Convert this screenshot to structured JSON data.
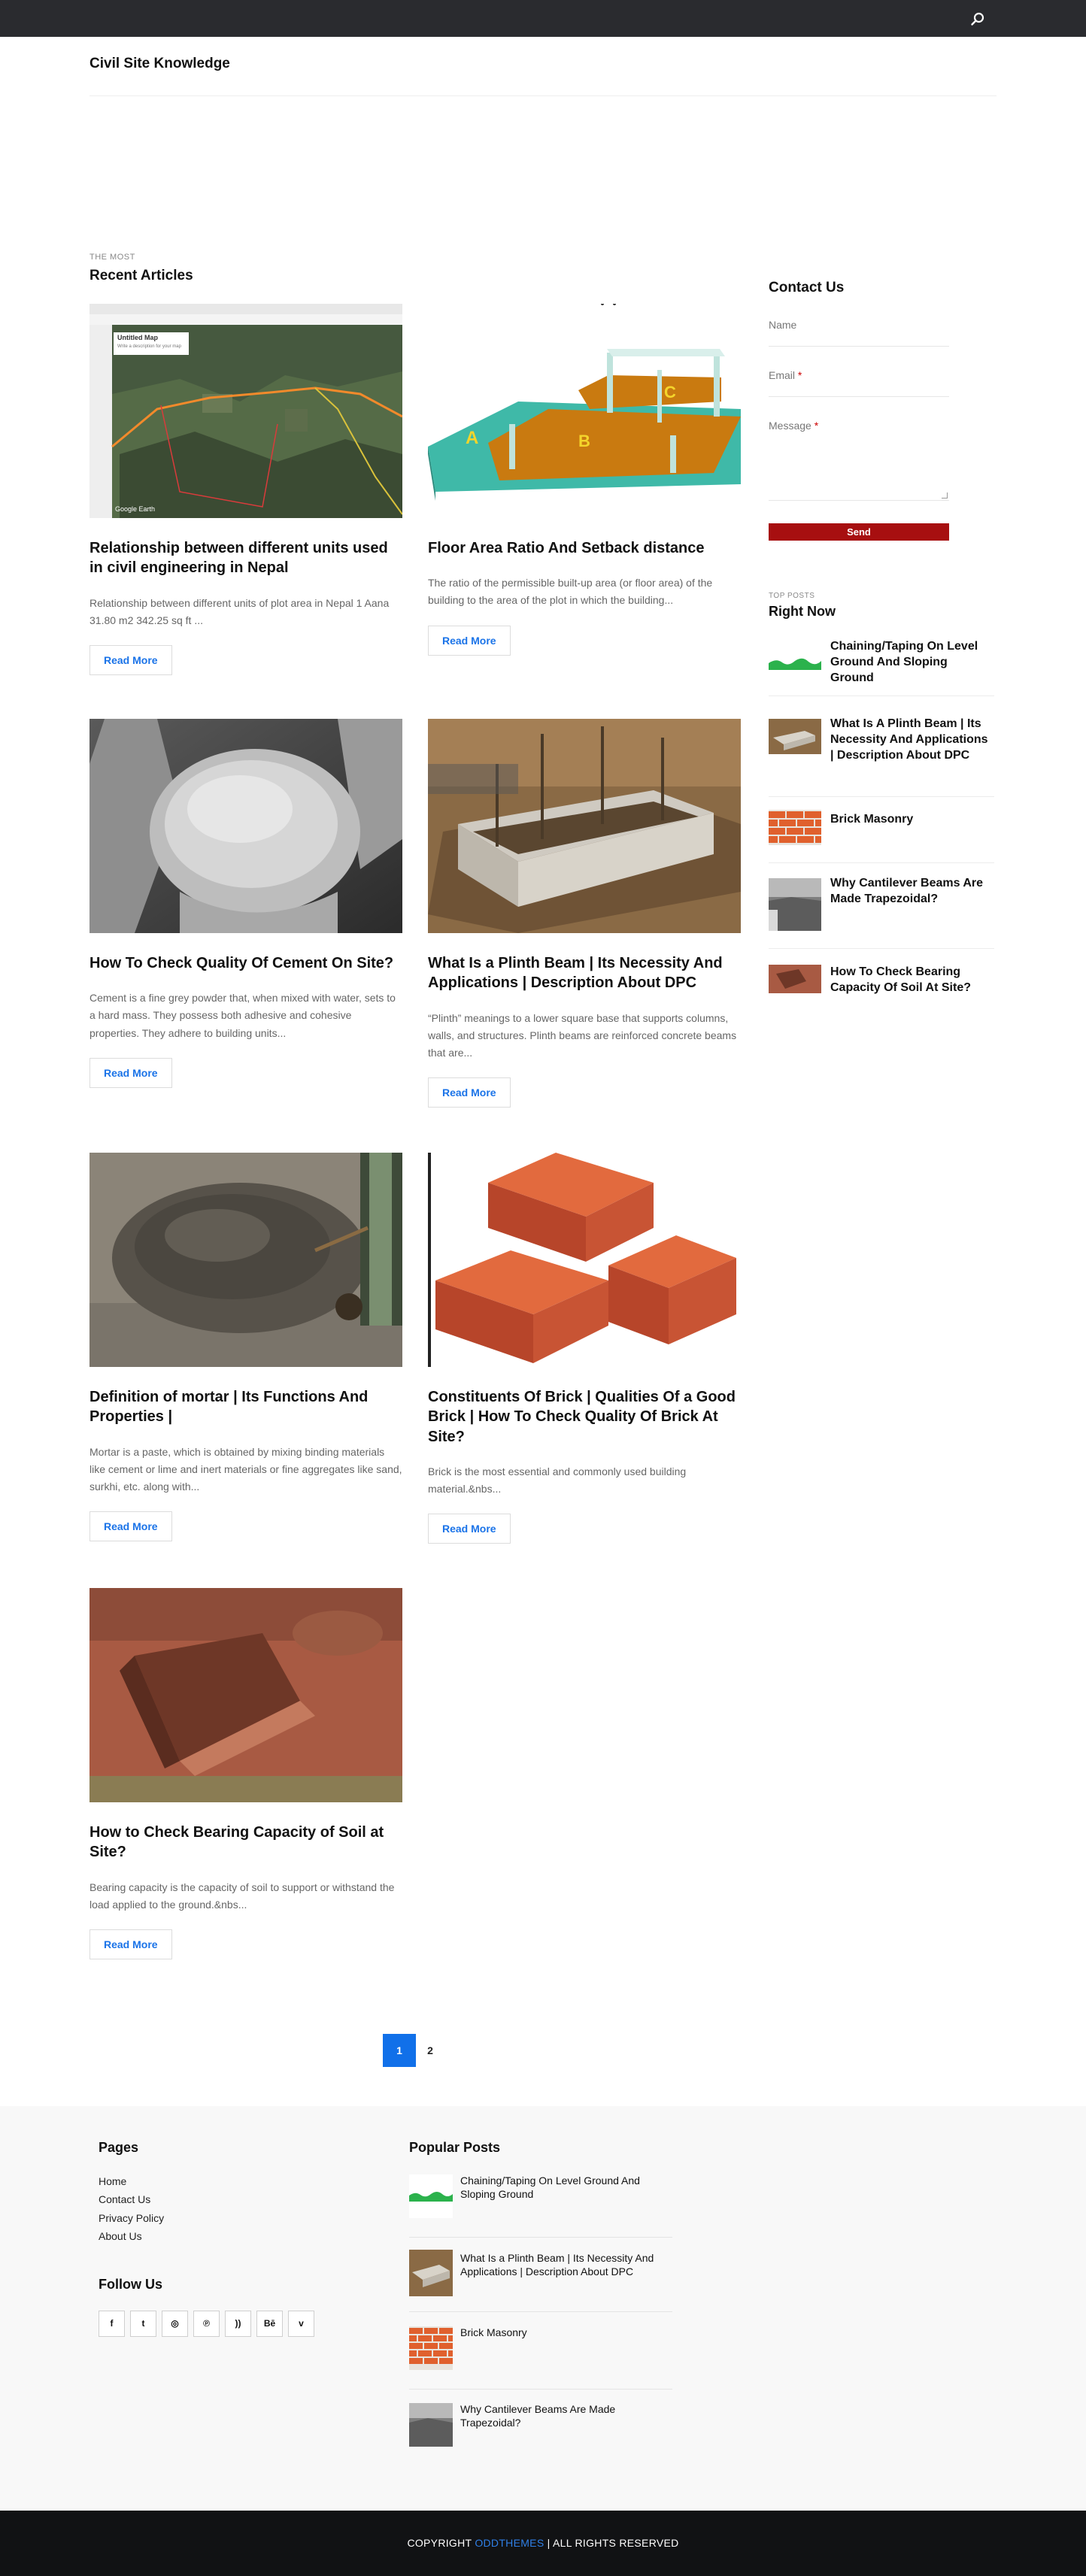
{
  "site": {
    "title": "Civil Site Knowledge"
  },
  "main": {
    "kicker": "The Most",
    "title": "Recent Articles",
    "read_more_label": "Read More",
    "articles": [
      {
        "title": "Relationship between different units used in civil engineering in Nepal",
        "excerpt": " Relationship between different units of plot area in Nepal   1 Aana 31.80 m2   342.25 sq ft     ...",
        "image": "satellite-map-image"
      },
      {
        "title": "Floor Area Ratio And Setback distance",
        "excerpt": "        The ratio of the permissible built-up area (or floor area) of the building to the area of the plot in which the building...",
        "image": "floor-area-diagram-image"
      },
      {
        "title": "How To Check Quality Of Cement On Site?",
        "excerpt": "Cement is a fine grey powder that, when mixed with water, sets to a hard mass. They possess both adhesive and cohesive properties. They adhere to building units...",
        "image": "cement-hands-image"
      },
      {
        "title": "What Is a Plinth Beam | Its Necessity And Applications | Description About DPC",
        "excerpt": "    “Plinth” meanings to a lower square base that supports columns, walls, and structures. Plinth beams are reinforced concrete beams that are...",
        "image": "plinth-beam-image"
      },
      {
        "title": "Definition of mortar | Its Functions And Properties |",
        "excerpt": "Mortar is a paste, which is obtained by mixing binding materials like cement or lime and inert materials or fine aggregates like sand, surkhi, etc. along with...",
        "image": "mortar-image"
      },
      {
        "title": "Constituents Of Brick | Qualities Of a Good Brick | How To Check Quality Of Brick At Site?",
        "excerpt": "Brick is the most essential and commonly used building material.&nbs...",
        "image": "bricks-image"
      },
      {
        "title": "How to Check Bearing Capacity of Soil at Site?",
        "excerpt": " Bearing capacity is the capacity of soil to support or withstand the load applied to the ground.&nbs...",
        "image": "soil-pit-image"
      }
    ],
    "map_card": {
      "map_title": "Untitled Map",
      "map_sub": "Write a description for your map",
      "watermark": "Google Earth"
    },
    "diagram_labels": [
      "A",
      "B",
      "C"
    ]
  },
  "sidebar": {
    "contact": {
      "title": "Contact Us",
      "name_label": "Name",
      "email_label": "Email",
      "message_label": "Message",
      "required_mark": "*",
      "send_label": "Send"
    },
    "top_posts": {
      "kicker": "Top Posts",
      "title": "Right Now",
      "items": [
        {
          "title": "Chaining/Taping On Level Ground And Sloping Ground"
        },
        {
          "title": "What Is A Plinth Beam | Its Necessity And Applications | Description About DPC"
        },
        {
          "title": "Brick Masonry"
        },
        {
          "title": "Why Cantilever Beams Are Made Trapezoidal?"
        },
        {
          "title": "How To Check Bearing Capacity Of Soil At Site?"
        }
      ]
    }
  },
  "pagination": {
    "pages": [
      "1",
      "2"
    ],
    "active": "1"
  },
  "footer": {
    "pages_title": "Pages",
    "pages_links": [
      "Home",
      "Contact Us",
      "Privacy Policy",
      "About Us"
    ],
    "follow_title": "Follow Us",
    "social": [
      {
        "icon": "facebook-icon",
        "glyph": "f"
      },
      {
        "icon": "twitter-icon",
        "glyph": "t"
      },
      {
        "icon": "instagram-icon",
        "glyph": "◎"
      },
      {
        "icon": "pinterest-icon",
        "glyph": "℗"
      },
      {
        "icon": "rss-icon",
        "glyph": "))"
      },
      {
        "icon": "behance-icon",
        "glyph": "Bē"
      },
      {
        "icon": "vimeo-icon",
        "glyph": "v"
      }
    ],
    "popular_title": "Popular Posts",
    "popular": [
      {
        "title": "Chaining/Taping On Level Ground And Sloping Ground"
      },
      {
        "title": "What Is a Plinth Beam | Its Necessity And Applications | Description About DPC"
      },
      {
        "title": "Brick Masonry"
      },
      {
        "title": "Why Cantilever Beams Are Made Trapezoidal?"
      }
    ],
    "copyright_prefix": "COPYRIGHT ",
    "copyright_brand": "ODDTHEMES",
    "copyright_suffix": " | ALL RIGHTS RESERVED"
  },
  "colors": {
    "accent": "#1170e9",
    "send": "#a70f10",
    "topbar": "#2a2b2f",
    "bottombar": "#111214"
  }
}
